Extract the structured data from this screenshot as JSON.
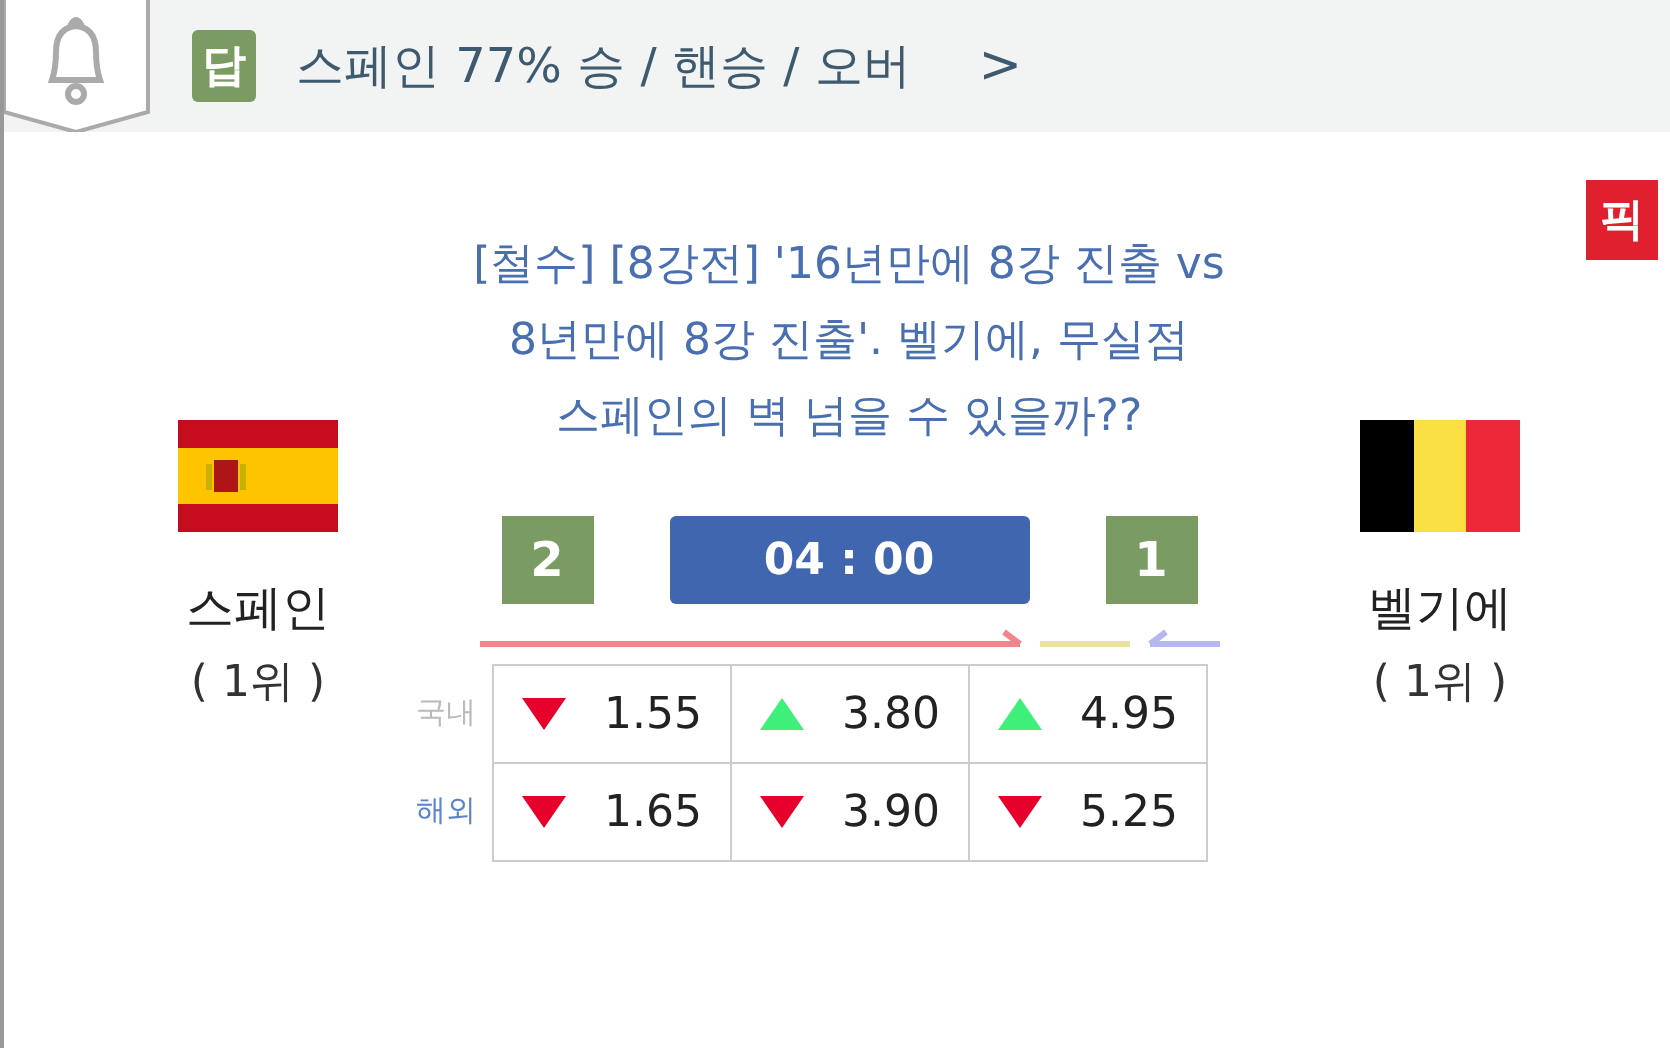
{
  "header": {
    "badge": "답",
    "text": "스페인 77% 승 / 핸승 / 오버",
    "chevron": ">"
  },
  "pick_badge": "픽",
  "headline": "[철수] [8강전] '16년만에 8강 진출 vs 8년만에 8강 진출'. 벨기에, 무실점 스페인의 벽 넘을 수 있을까??",
  "home": {
    "name": "스페인",
    "rank": "( 1위 )",
    "score": "2"
  },
  "away": {
    "name": "벨기에",
    "rank": "( 1위 )",
    "score": "1"
  },
  "time": "04 : 00",
  "odds": [
    {
      "label": "국내",
      "selected": false,
      "cells": [
        {
          "kind": "down",
          "value": "1.55"
        },
        {
          "kind": "up",
          "value": "3.80"
        },
        {
          "kind": "up",
          "value": "4.95"
        }
      ]
    },
    {
      "label": "해외",
      "selected": true,
      "cells": [
        {
          "kind": "down",
          "value": "1.65"
        },
        {
          "kind": "down",
          "value": "3.90"
        },
        {
          "kind": "down",
          "value": "5.25"
        }
      ]
    }
  ]
}
